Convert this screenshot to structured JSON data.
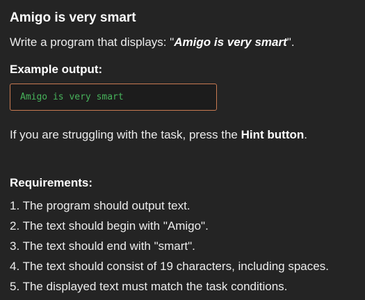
{
  "task": {
    "title": "Amigo is very smart",
    "intro_prefix": "Write a program that displays: \"",
    "intro_quote": "Amigo is very smart",
    "intro_suffix": "\".",
    "example_heading": "Example output:",
    "example_output": "Amigo is very smart",
    "hint_prefix": "If you are struggling with the task, press the ",
    "hint_strong": "Hint button",
    "hint_suffix": ".",
    "requirements_heading": "Requirements:",
    "requirements": [
      "1. The program should output text.",
      "2. The text should begin with \"Amigo\".",
      "3. The text should end with \"smart\".",
      "4. The text should consist of 19 characters, including spaces.",
      "5. The displayed text must match the task conditions."
    ]
  },
  "colors": {
    "background": "#242424",
    "output_border": "#c87a52",
    "output_text": "#47b35b"
  }
}
